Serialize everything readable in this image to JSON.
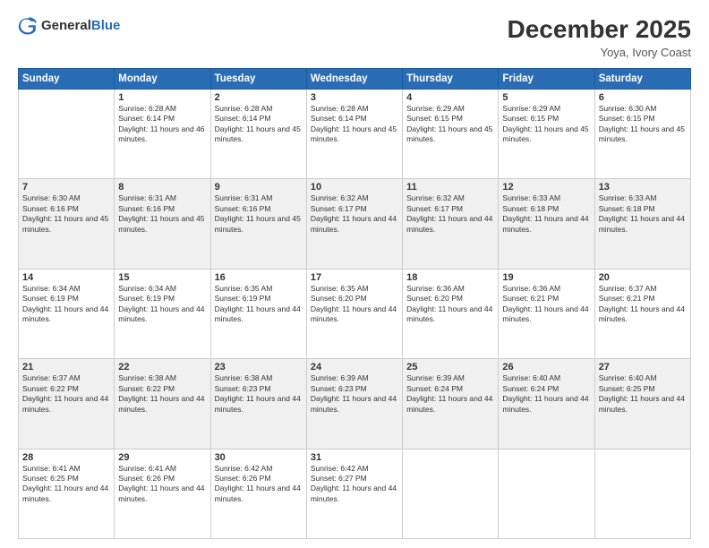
{
  "header": {
    "logo_general": "General",
    "logo_blue": "Blue",
    "month_title": "December 2025",
    "location": "Yoya, Ivory Coast"
  },
  "days_of_week": [
    "Sunday",
    "Monday",
    "Tuesday",
    "Wednesday",
    "Thursday",
    "Friday",
    "Saturday"
  ],
  "weeks": [
    [
      {
        "day": "",
        "sunrise": "",
        "sunset": "",
        "daylight": ""
      },
      {
        "day": "1",
        "sunrise": "Sunrise: 6:28 AM",
        "sunset": "Sunset: 6:14 PM",
        "daylight": "Daylight: 11 hours and 46 minutes."
      },
      {
        "day": "2",
        "sunrise": "Sunrise: 6:28 AM",
        "sunset": "Sunset: 6:14 PM",
        "daylight": "Daylight: 11 hours and 45 minutes."
      },
      {
        "day": "3",
        "sunrise": "Sunrise: 6:28 AM",
        "sunset": "Sunset: 6:14 PM",
        "daylight": "Daylight: 11 hours and 45 minutes."
      },
      {
        "day": "4",
        "sunrise": "Sunrise: 6:29 AM",
        "sunset": "Sunset: 6:15 PM",
        "daylight": "Daylight: 11 hours and 45 minutes."
      },
      {
        "day": "5",
        "sunrise": "Sunrise: 6:29 AM",
        "sunset": "Sunset: 6:15 PM",
        "daylight": "Daylight: 11 hours and 45 minutes."
      },
      {
        "day": "6",
        "sunrise": "Sunrise: 6:30 AM",
        "sunset": "Sunset: 6:15 PM",
        "daylight": "Daylight: 11 hours and 45 minutes."
      }
    ],
    [
      {
        "day": "7",
        "sunrise": "Sunrise: 6:30 AM",
        "sunset": "Sunset: 6:16 PM",
        "daylight": "Daylight: 11 hours and 45 minutes."
      },
      {
        "day": "8",
        "sunrise": "Sunrise: 6:31 AM",
        "sunset": "Sunset: 6:16 PM",
        "daylight": "Daylight: 11 hours and 45 minutes."
      },
      {
        "day": "9",
        "sunrise": "Sunrise: 6:31 AM",
        "sunset": "Sunset: 6:16 PM",
        "daylight": "Daylight: 11 hours and 45 minutes."
      },
      {
        "day": "10",
        "sunrise": "Sunrise: 6:32 AM",
        "sunset": "Sunset: 6:17 PM",
        "daylight": "Daylight: 11 hours and 44 minutes."
      },
      {
        "day": "11",
        "sunrise": "Sunrise: 6:32 AM",
        "sunset": "Sunset: 6:17 PM",
        "daylight": "Daylight: 11 hours and 44 minutes."
      },
      {
        "day": "12",
        "sunrise": "Sunrise: 6:33 AM",
        "sunset": "Sunset: 6:18 PM",
        "daylight": "Daylight: 11 hours and 44 minutes."
      },
      {
        "day": "13",
        "sunrise": "Sunrise: 6:33 AM",
        "sunset": "Sunset: 6:18 PM",
        "daylight": "Daylight: 11 hours and 44 minutes."
      }
    ],
    [
      {
        "day": "14",
        "sunrise": "Sunrise: 6:34 AM",
        "sunset": "Sunset: 6:19 PM",
        "daylight": "Daylight: 11 hours and 44 minutes."
      },
      {
        "day": "15",
        "sunrise": "Sunrise: 6:34 AM",
        "sunset": "Sunset: 6:19 PM",
        "daylight": "Daylight: 11 hours and 44 minutes."
      },
      {
        "day": "16",
        "sunrise": "Sunrise: 6:35 AM",
        "sunset": "Sunset: 6:19 PM",
        "daylight": "Daylight: 11 hours and 44 minutes."
      },
      {
        "day": "17",
        "sunrise": "Sunrise: 6:35 AM",
        "sunset": "Sunset: 6:20 PM",
        "daylight": "Daylight: 11 hours and 44 minutes."
      },
      {
        "day": "18",
        "sunrise": "Sunrise: 6:36 AM",
        "sunset": "Sunset: 6:20 PM",
        "daylight": "Daylight: 11 hours and 44 minutes."
      },
      {
        "day": "19",
        "sunrise": "Sunrise: 6:36 AM",
        "sunset": "Sunset: 6:21 PM",
        "daylight": "Daylight: 11 hours and 44 minutes."
      },
      {
        "day": "20",
        "sunrise": "Sunrise: 6:37 AM",
        "sunset": "Sunset: 6:21 PM",
        "daylight": "Daylight: 11 hours and 44 minutes."
      }
    ],
    [
      {
        "day": "21",
        "sunrise": "Sunrise: 6:37 AM",
        "sunset": "Sunset: 6:22 PM",
        "daylight": "Daylight: 11 hours and 44 minutes."
      },
      {
        "day": "22",
        "sunrise": "Sunrise: 6:38 AM",
        "sunset": "Sunset: 6:22 PM",
        "daylight": "Daylight: 11 hours and 44 minutes."
      },
      {
        "day": "23",
        "sunrise": "Sunrise: 6:38 AM",
        "sunset": "Sunset: 6:23 PM",
        "daylight": "Daylight: 11 hours and 44 minutes."
      },
      {
        "day": "24",
        "sunrise": "Sunrise: 6:39 AM",
        "sunset": "Sunset: 6:23 PM",
        "daylight": "Daylight: 11 hours and 44 minutes."
      },
      {
        "day": "25",
        "sunrise": "Sunrise: 6:39 AM",
        "sunset": "Sunset: 6:24 PM",
        "daylight": "Daylight: 11 hours and 44 minutes."
      },
      {
        "day": "26",
        "sunrise": "Sunrise: 6:40 AM",
        "sunset": "Sunset: 6:24 PM",
        "daylight": "Daylight: 11 hours and 44 minutes."
      },
      {
        "day": "27",
        "sunrise": "Sunrise: 6:40 AM",
        "sunset": "Sunset: 6:25 PM",
        "daylight": "Daylight: 11 hours and 44 minutes."
      }
    ],
    [
      {
        "day": "28",
        "sunrise": "Sunrise: 6:41 AM",
        "sunset": "Sunset: 6:25 PM",
        "daylight": "Daylight: 11 hours and 44 minutes."
      },
      {
        "day": "29",
        "sunrise": "Sunrise: 6:41 AM",
        "sunset": "Sunset: 6:26 PM",
        "daylight": "Daylight: 11 hours and 44 minutes."
      },
      {
        "day": "30",
        "sunrise": "Sunrise: 6:42 AM",
        "sunset": "Sunset: 6:26 PM",
        "daylight": "Daylight: 11 hours and 44 minutes."
      },
      {
        "day": "31",
        "sunrise": "Sunrise: 6:42 AM",
        "sunset": "Sunset: 6:27 PM",
        "daylight": "Daylight: 11 hours and 44 minutes."
      },
      {
        "day": "",
        "sunrise": "",
        "sunset": "",
        "daylight": ""
      },
      {
        "day": "",
        "sunrise": "",
        "sunset": "",
        "daylight": ""
      },
      {
        "day": "",
        "sunrise": "",
        "sunset": "",
        "daylight": ""
      }
    ]
  ]
}
